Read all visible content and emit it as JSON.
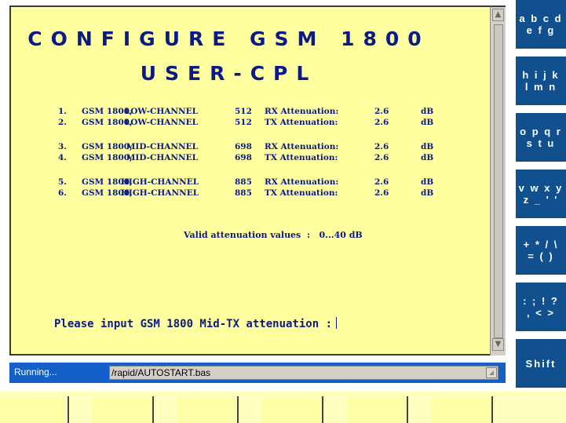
{
  "title": {
    "line1": "CONFIGURE GSM 1800",
    "line2": "USER-CPL"
  },
  "rows": [
    {
      "num": "1.",
      "band": "GSM 1800,",
      "channel": "LOW-CHANNEL",
      "arfcn": "512",
      "direction": "RX Attenuation:",
      "value": "2.6",
      "unit": "dB"
    },
    {
      "num": "2.",
      "band": "GSM 1800,",
      "channel": "LOW-CHANNEL",
      "arfcn": "512",
      "direction": "TX Attenuation:",
      "value": "2.6",
      "unit": "dB"
    },
    {
      "num": "3.",
      "band": "GSM 1800,",
      "channel": "MID-CHANNEL",
      "arfcn": "698",
      "direction": "RX Attenuation:",
      "value": "2.6",
      "unit": "dB"
    },
    {
      "num": "4.",
      "band": "GSM 1800,",
      "channel": "MID-CHANNEL",
      "arfcn": "698",
      "direction": "TX Attenuation:",
      "value": "2.6",
      "unit": "dB"
    },
    {
      "num": "5.",
      "band": "GSM 1800,",
      "channel": "HIGH-CHANNEL",
      "arfcn": "885",
      "direction": "RX Attenuation:",
      "value": "2.6",
      "unit": "dB"
    },
    {
      "num": "6.",
      "band": "GSM 1800,",
      "channel": "HIGH-CHANNEL",
      "arfcn": "885",
      "direction": "TX Attenuation:",
      "value": "2.6",
      "unit": "dB"
    }
  ],
  "valid_text": "Valid attenuation values  :   0...40 dB",
  "prompt": "Please input GSM 1800 Mid-TX attenuation :",
  "softkeys": [
    "a b c d\ne f g",
    "h i j k\nl m n",
    "o p q r\ns t u",
    "v w x y\nz _ ' '",
    "+ * / \\\n= ( )",
    ": ; ! ?\n, < >",
    "Shift"
  ],
  "status": {
    "text": "Running...",
    "path": "/rapid/AUTOSTART.bas"
  },
  "icons": {
    "scroll_up": "scroll-up-arrow-icon",
    "scroll_down": "scroll-down-arrow-icon",
    "path_button": "dropdown-icon"
  },
  "colors": {
    "display_bg": "#ffff9f",
    "text": "#0a1a86",
    "softkey_bg": "#11508e",
    "status_bg": "#1560c8"
  }
}
